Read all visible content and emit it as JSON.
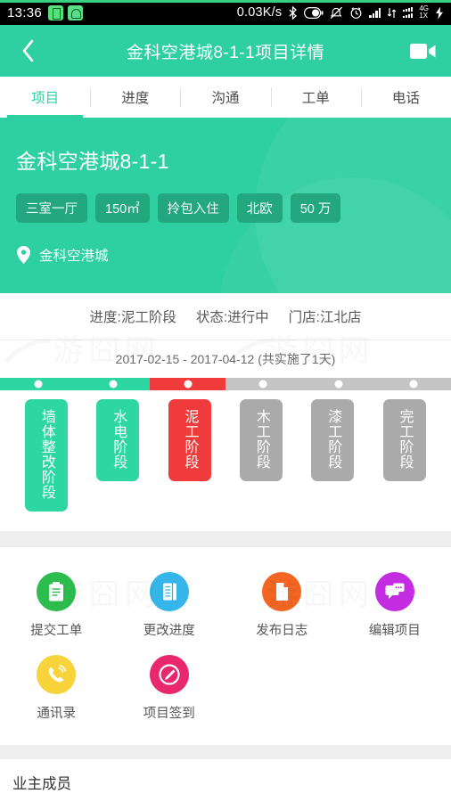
{
  "statusbar": {
    "time": "13:36",
    "network_speed": "0.03K/s",
    "network_label_top": "4G",
    "network_label_bottom": "1X",
    "icons": [
      "battery-app-icon",
      "robot-app-icon",
      "bluetooth-icon",
      "battery-icon",
      "mute-icon",
      "alarm-icon",
      "signal-icon",
      "data-transfer-icon",
      "dual-signal-icon",
      "charging-bolt-icon"
    ]
  },
  "header": {
    "title": "金科空港城8-1-1项目详情",
    "back_icon": "chevron-left-icon",
    "video_icon": "video-camera-icon",
    "accent_color": "#2ecfa0"
  },
  "tabs": [
    {
      "label": "项目",
      "active": true
    },
    {
      "label": "进度",
      "active": false
    },
    {
      "label": "沟通",
      "active": false
    },
    {
      "label": "工单",
      "active": false
    },
    {
      "label": "电话",
      "active": false
    }
  ],
  "hero": {
    "title": "金科空港城8-1-1",
    "tags": [
      "三室一厅",
      "150㎡",
      "拎包入住",
      "北欧",
      "50 万"
    ],
    "location_icon": "map-pin-icon",
    "location": "金科空港城"
  },
  "info": {
    "progress": "进度:泥工阶段",
    "status": "状态:进行中",
    "store": "门店:江北店",
    "date_range": "2017-02-15 - 2017-04-12 (共实施了1天)"
  },
  "progress": {
    "colors": {
      "done": "#2ed6a2",
      "current": "#ef3b3b",
      "todo": "#c4c4c4"
    },
    "stages": [
      {
        "label": "墙体整改阶段",
        "state": "done"
      },
      {
        "label": "水电阶段",
        "state": "done"
      },
      {
        "label": "泥工阶段",
        "state": "current"
      },
      {
        "label": "木工阶段",
        "state": "todo"
      },
      {
        "label": "漆工阶段",
        "state": "todo"
      },
      {
        "label": "完工阶段",
        "state": "todo"
      }
    ]
  },
  "actions": [
    {
      "label": "提交工单",
      "icon": "clipboard-icon",
      "color": "#2cbd4e"
    },
    {
      "label": "更改进度",
      "icon": "notebook-icon",
      "color": "#35b5e8"
    },
    {
      "label": "发布日志",
      "icon": "document-icon",
      "color": "#f26522"
    },
    {
      "label": "编辑项目",
      "icon": "chat-bubble-icon",
      "color": "#c32ce0"
    },
    {
      "label": "通讯录",
      "icon": "phone-icon",
      "color": "#f7d33c"
    },
    {
      "label": "项目签到",
      "icon": "pen-circle-icon",
      "color": "#e8276d"
    }
  ],
  "owner_section": {
    "title": "业主成员"
  },
  "watermark": {
    "text": "游囧网"
  }
}
